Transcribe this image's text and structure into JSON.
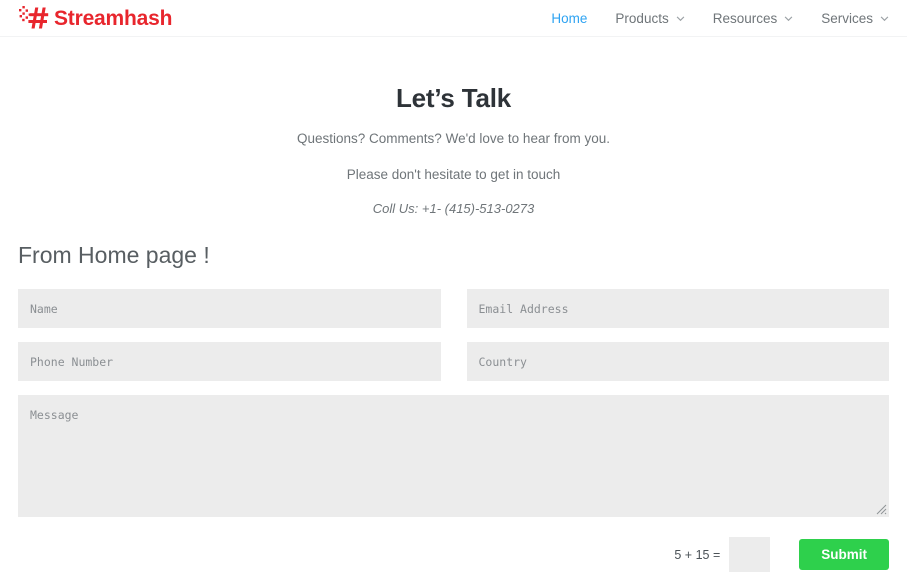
{
  "header": {
    "brand": {
      "name": "Streamhash",
      "logo_icon": "hashtag-pixel-logo",
      "color": "#e8262d"
    },
    "nav": [
      {
        "label": "Home",
        "has_dropdown": false,
        "active": true
      },
      {
        "label": "Products",
        "has_dropdown": true,
        "active": false
      },
      {
        "label": "Resources",
        "has_dropdown": true,
        "active": false
      },
      {
        "label": "Services",
        "has_dropdown": true,
        "active": false
      }
    ],
    "nav_active_color": "#2ea3f2",
    "nav_color": "#6f7579"
  },
  "hero": {
    "title": "Let’s Talk",
    "line1": "Questions? Comments? We'd love to hear from you.",
    "line2": "Please don't hesitate to get in touch",
    "phone": "Coll Us: +1- (415)-513-0273"
  },
  "form": {
    "section_title": "From Home page !",
    "fields": [
      {
        "name": "name",
        "placeholder": "Name",
        "value": ""
      },
      {
        "name": "email",
        "placeholder": "Email Address",
        "value": ""
      },
      {
        "name": "phone",
        "placeholder": "Phone Number",
        "value": ""
      },
      {
        "name": "country",
        "placeholder": "Country",
        "value": ""
      }
    ],
    "message": {
      "placeholder": "Message",
      "value": ""
    },
    "captcha": {
      "label": "5 + 15 =",
      "placeholder": "",
      "value": ""
    },
    "submit_label": "Submit",
    "submit_color": "#2ed04c",
    "field_background": "#ececec"
  }
}
